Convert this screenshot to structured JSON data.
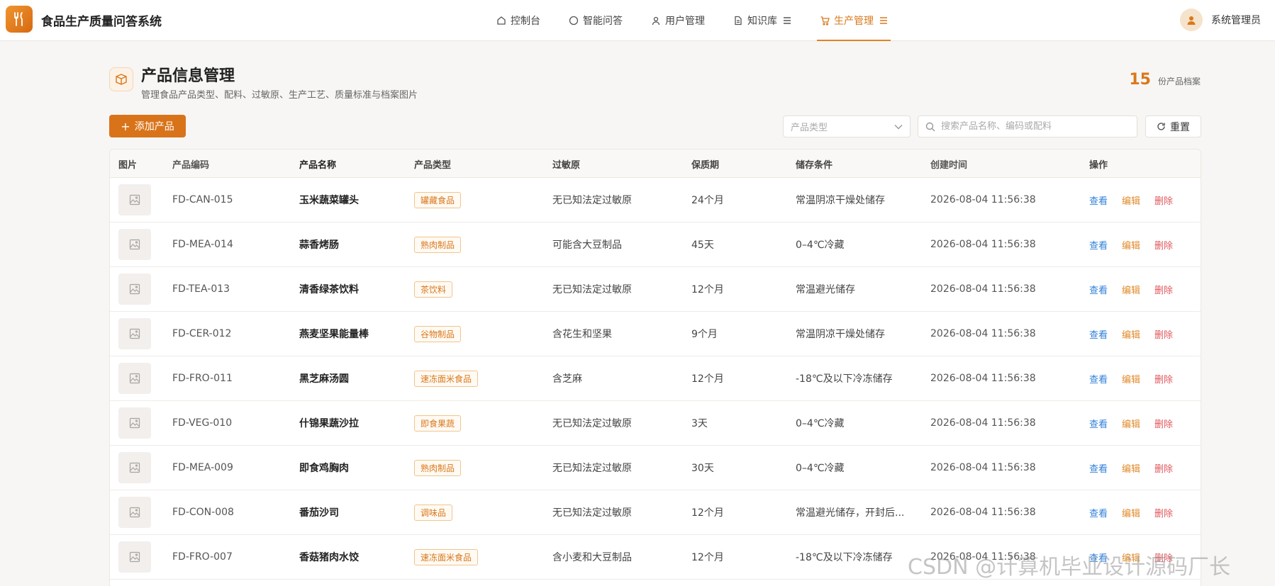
{
  "app": {
    "title": "食品生产质量问答系统"
  },
  "nav": [
    {
      "label": "控制台",
      "icon": "home-icon",
      "active": false
    },
    {
      "label": "智能问答",
      "icon": "chat-icon",
      "active": false
    },
    {
      "label": "用户管理",
      "icon": "user-icon",
      "active": false
    },
    {
      "label": "知识库",
      "icon": "document-icon",
      "active": false
    },
    {
      "label": "生产管理",
      "icon": "cart-icon",
      "active": true
    }
  ],
  "user": {
    "name": "系统管理员"
  },
  "header": {
    "title": "产品信息管理",
    "subtitle": "管理食品产品类型、配料、过敏原、生产工艺、质量标准与档案图片",
    "count": "15",
    "count_label": "份产品档案"
  },
  "toolbar": {
    "add_label": "添加产品",
    "type_placeholder": "产品类型",
    "search_placeholder": "搜索产品名称、编码或配料",
    "reset_label": "重置"
  },
  "table": {
    "columns": [
      "图片",
      "产品编码",
      "产品名称",
      "产品类型",
      "过敏原",
      "保质期",
      "储存条件",
      "创建时间",
      "操作"
    ],
    "actions": {
      "view": "查看",
      "edit": "编辑",
      "delete": "删除"
    },
    "rows": [
      {
        "code": "FD-CAN-015",
        "name": "玉米蔬菜罐头",
        "type": "罐藏食品",
        "allergen": "无已知法定过敏原",
        "shelf": "24个月",
        "storage": "常温阴凉干燥处储存",
        "created": "2026-08-04 11:56:38"
      },
      {
        "code": "FD-MEA-014",
        "name": "蒜香烤肠",
        "type": "熟肉制品",
        "allergen": "可能含大豆制品",
        "shelf": "45天",
        "storage": "0–4℃冷藏",
        "created": "2026-08-04 11:56:38"
      },
      {
        "code": "FD-TEA-013",
        "name": "清香绿茶饮料",
        "type": "茶饮料",
        "allergen": "无已知法定过敏原",
        "shelf": "12个月",
        "storage": "常温避光储存",
        "created": "2026-08-04 11:56:38"
      },
      {
        "code": "FD-CER-012",
        "name": "燕麦坚果能量棒",
        "type": "谷物制品",
        "allergen": "含花生和坚果",
        "shelf": "9个月",
        "storage": "常温阴凉干燥处储存",
        "created": "2026-08-04 11:56:38"
      },
      {
        "code": "FD-FRO-011",
        "name": "黑芝麻汤圆",
        "type": "速冻面米食品",
        "allergen": "含芝麻",
        "shelf": "12个月",
        "storage": "-18℃及以下冷冻储存",
        "created": "2026-08-04 11:56:38"
      },
      {
        "code": "FD-VEG-010",
        "name": "什锦果蔬沙拉",
        "type": "即食果蔬",
        "allergen": "无已知法定过敏原",
        "shelf": "3天",
        "storage": "0–4℃冷藏",
        "created": "2026-08-04 11:56:38"
      },
      {
        "code": "FD-MEA-009",
        "name": "即食鸡胸肉",
        "type": "熟肉制品",
        "allergen": "无已知法定过敏原",
        "shelf": "30天",
        "storage": "0–4℃冷藏",
        "created": "2026-08-04 11:56:38"
      },
      {
        "code": "FD-CON-008",
        "name": "番茄沙司",
        "type": "调味品",
        "allergen": "无已知法定过敏原",
        "shelf": "12个月",
        "storage": "常温避光储存，开封后...",
        "created": "2026-08-04 11:56:38"
      },
      {
        "code": "FD-FRO-007",
        "name": "香菇猪肉水饺",
        "type": "速冻面米食品",
        "allergen": "含小麦和大豆制品",
        "shelf": "12个月",
        "storage": "-18℃及以下冷冻储存",
        "created": "2026-08-04 11:56:38"
      }
    ]
  },
  "watermark": "CSDN @计算机毕业设计源码厂长",
  "colors": {
    "accent": "#d9781c",
    "view": "#2f7fd8",
    "edit": "#e08a2a",
    "delete": "#e2585d"
  }
}
